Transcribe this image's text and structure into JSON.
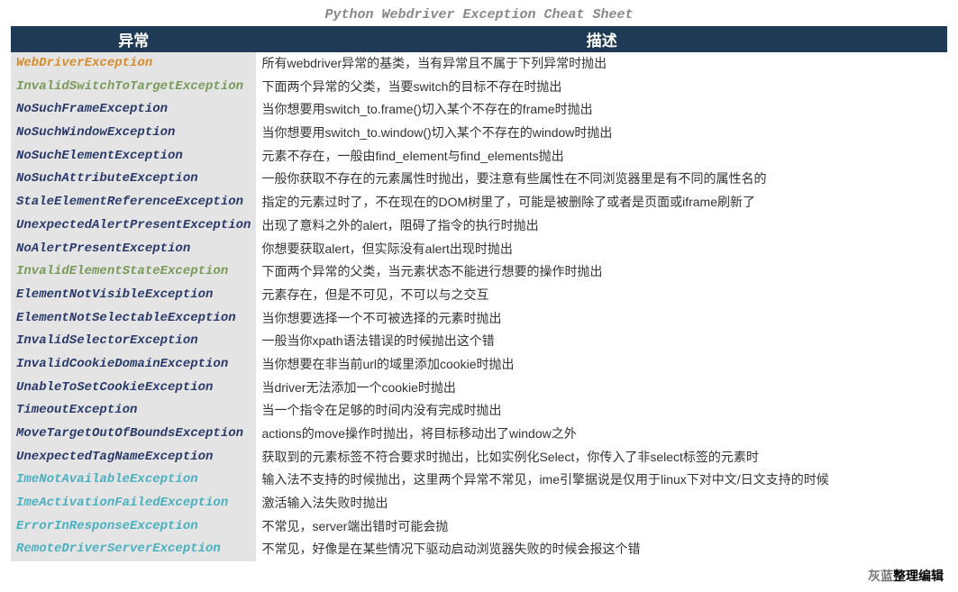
{
  "title": "Python Webdriver Exception Cheat Sheet",
  "headers": {
    "col1": "异常",
    "col2": "描述"
  },
  "rows": [
    {
      "name": "WebDriverException",
      "color": "c-orange",
      "desc": "所有webdriver异常的基类，当有异常且不属于下列异常时抛出"
    },
    {
      "name": "InvalidSwitchToTargetException",
      "color": "c-olive",
      "desc": "下面两个异常的父类，当要switch的目标不存在时抛出"
    },
    {
      "name": "NoSuchFrameException",
      "color": "c-navy",
      "desc": "当你想要用switch_to.frame()切入某个不存在的frame时抛出"
    },
    {
      "name": "NoSuchWindowException",
      "color": "c-navy",
      "desc": "当你想要用switch_to.window()切入某个不存在的window时抛出"
    },
    {
      "name": "NoSuchElementException",
      "color": "c-navy",
      "desc": "元素不存在，一般由find_element与find_elements抛出"
    },
    {
      "name": "NoSuchAttributeException",
      "color": "c-navy",
      "desc": "一般你获取不存在的元素属性时抛出，要注意有些属性在不同浏览器里是有不同的属性名的"
    },
    {
      "name": "StaleElementReferenceException",
      "color": "c-navy",
      "desc": "指定的元素过时了，不在现在的DOM树里了，可能是被删除了或者是页面或iframe刷新了"
    },
    {
      "name": "UnexpectedAlertPresentException",
      "color": "c-navy",
      "desc": "出现了意料之外的alert，阻碍了指令的执行时抛出"
    },
    {
      "name": "NoAlertPresentException",
      "color": "c-navy",
      "desc": "你想要获取alert，但实际没有alert出现时抛出"
    },
    {
      "name": "InvalidElementStateException",
      "color": "c-olive",
      "desc": "下面两个异常的父类，当元素状态不能进行想要的操作时抛出"
    },
    {
      "name": "ElementNotVisibleException",
      "color": "c-navy",
      "desc": "元素存在，但是不可见，不可以与之交互"
    },
    {
      "name": "ElementNotSelectableException",
      "color": "c-navy",
      "desc": "当你想要选择一个不可被选择的元素时抛出"
    },
    {
      "name": "InvalidSelectorException",
      "color": "c-navy",
      "desc": "一般当你xpath语法错误的时候抛出这个错"
    },
    {
      "name": "InvalidCookieDomainException",
      "color": "c-navy",
      "desc": "当你想要在非当前url的域里添加cookie时抛出"
    },
    {
      "name": "UnableToSetCookieException",
      "color": "c-navy",
      "desc": "当driver无法添加一个cookie时抛出"
    },
    {
      "name": "TimeoutException",
      "color": "c-navy",
      "desc": "当一个指令在足够的时间内没有完成时抛出"
    },
    {
      "name": "MoveTargetOutOfBoundsException",
      "color": "c-navy",
      "desc": "actions的move操作时抛出，将目标移动出了window之外"
    },
    {
      "name": "UnexpectedTagNameException",
      "color": "c-navy",
      "desc": "获取到的元素标签不符合要求时抛出，比如实例化Select，你传入了非select标签的元素时"
    },
    {
      "name": "ImeNotAvailableException",
      "color": "c-teal",
      "desc": "输入法不支持的时候抛出，这里两个异常不常见，ime引擎据说是仅用于linux下对中文/日文支持的时候"
    },
    {
      "name": "ImeActivationFailedException",
      "color": "c-teal",
      "desc": "激活输入法失败时抛出"
    },
    {
      "name": "ErrorInResponseException",
      "color": "c-teal",
      "desc": "不常见，server端出错时可能会抛"
    },
    {
      "name": "RemoteDriverServerException",
      "color": "c-teal",
      "desc": "不常见，好像是在某些情况下驱动启动浏览器失败的时候会报这个错"
    }
  ],
  "footer": {
    "part1": "灰蓝",
    "part2": "整理编辑"
  }
}
